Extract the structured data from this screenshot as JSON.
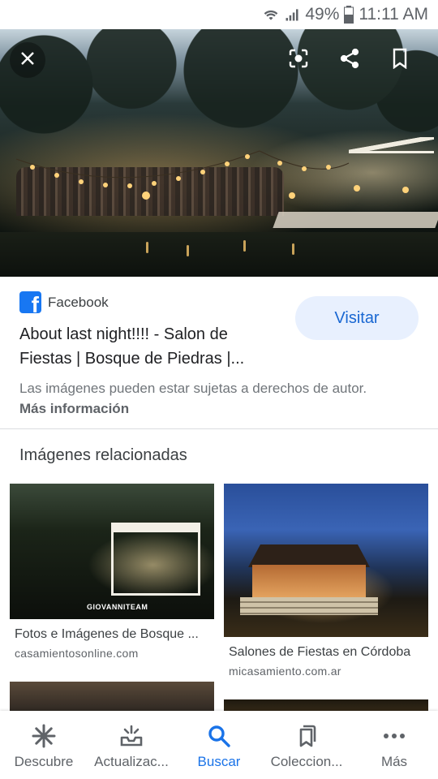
{
  "status_bar": {
    "battery": "49%",
    "time": "11:11 AM",
    "icons": [
      "wifi-icon",
      "signal-icon",
      "battery-icon"
    ]
  },
  "hero": {
    "actions": [
      "close-icon",
      "lens-icon",
      "share-icon",
      "bookmark-icon"
    ]
  },
  "result": {
    "source": "Facebook",
    "visit_label": "Visitar",
    "title": "About last night!!!! - Salon de Fiestas | Bosque de Piedras |...",
    "rights_notice": "Las imágenes pueden estar sujetas a derechos de autor.",
    "more_info": "Más información"
  },
  "related": {
    "heading": "Imágenes relacionadas",
    "items": [
      {
        "caption": "Fotos e Imágenes de Bosque ...",
        "domain": "casamientosonline.com",
        "watermark": "GIOVANNITEAM"
      },
      {
        "caption": "Salones de Fiestas en Córdoba",
        "domain": "micasamiento.com.ar"
      }
    ]
  },
  "bottom_nav": {
    "items": [
      {
        "label": "Descubre",
        "icon": "asterisk-icon"
      },
      {
        "label": "Actualizac...",
        "icon": "updates-icon"
      },
      {
        "label": "Buscar",
        "icon": "search-icon"
      },
      {
        "label": "Coleccion...",
        "icon": "collections-icon"
      },
      {
        "label": "Más",
        "icon": "more-dots-icon"
      }
    ],
    "active": "Buscar",
    "active_color": "#1a73e8"
  }
}
